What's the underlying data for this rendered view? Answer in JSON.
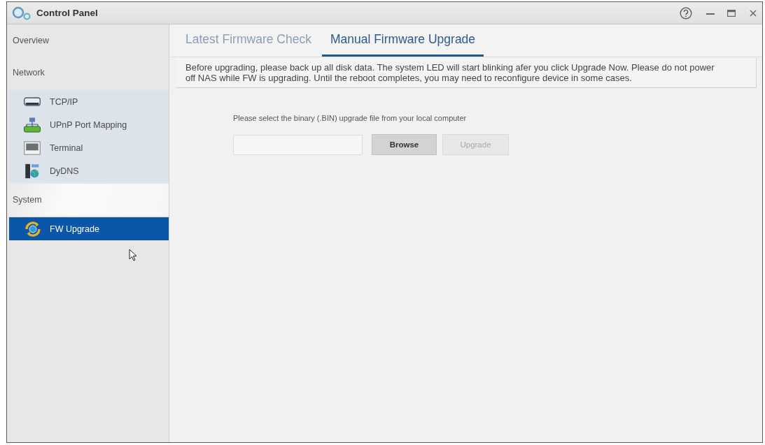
{
  "window": {
    "title": "Control Panel"
  },
  "sidebar": {
    "groups": [
      {
        "label": "Overview"
      },
      {
        "label": "Network",
        "items": [
          {
            "label": "TCP/IP",
            "kind": "device",
            "selected": false
          },
          {
            "label": "UPnP Port Mapping",
            "kind": "network",
            "selected": false
          },
          {
            "label": "Terminal",
            "kind": "monitor",
            "selected": false
          },
          {
            "label": "DyDNS",
            "kind": "globe",
            "selected": false
          }
        ]
      },
      {
        "label": "System",
        "items": [
          {
            "label": "FW Upgrade",
            "kind": "upgrade",
            "selected": true
          }
        ]
      }
    ]
  },
  "tabs": [
    {
      "label": "Latest Firmware Check",
      "selected": false
    },
    {
      "label": "Manual Firmware Upgrade",
      "selected": true
    }
  ],
  "notice": "Before upgrading, please back up all disk data. The system LED will start blinking afer you click Upgrade Now. Please do not power off NAS while FW is upgrading. Until the reboot completes, you may need to reconfigure device in some cases.",
  "upload": {
    "instruction": "Please select the binary (.BIN) upgrade file from your local computer",
    "buttons": [
      {
        "label": "Browse",
        "disabled": false
      },
      {
        "label": "Upgrade",
        "disabled": true
      }
    ]
  }
}
